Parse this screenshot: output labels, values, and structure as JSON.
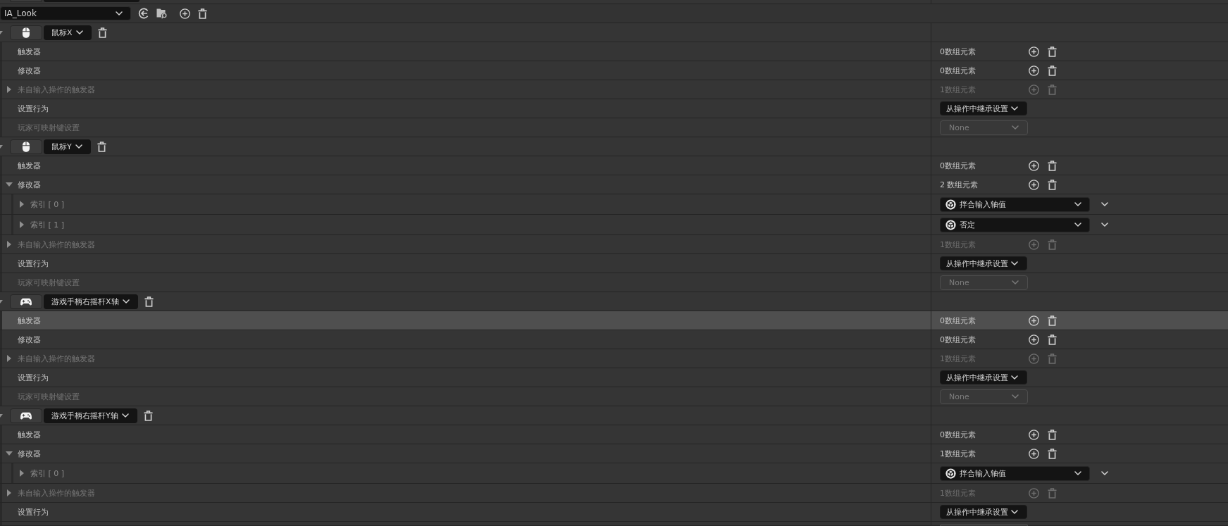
{
  "action": {
    "name": "IA_Look"
  },
  "mappings": [
    {
      "kind": "mouse",
      "key": "鼠标X",
      "expanded": true,
      "rows": [
        {
          "kind": "array",
          "label": "触发器",
          "count": "0数组元素",
          "disabled": false,
          "highlighted": false
        },
        {
          "kind": "array",
          "label": "修改器",
          "count": "0数组元素",
          "disabled": false,
          "highlighted": false
        },
        {
          "kind": "array",
          "label": "来自输入操作的触发器",
          "count": "1数组元素",
          "disabled": true,
          "highlighted": false,
          "expanded": false
        },
        {
          "kind": "dropdown",
          "label": "设置行为",
          "value": "从操作中继承设置",
          "disabled": false,
          "highlighted": false
        },
        {
          "kind": "dropdown",
          "label": "玩家可映射键设置",
          "value": "None",
          "disabled": true,
          "highlighted": false
        }
      ]
    },
    {
      "kind": "mouse",
      "key": "鼠标Y",
      "expanded": true,
      "rows": [
        {
          "kind": "array",
          "label": "触发器",
          "count": "0数组元素",
          "disabled": false,
          "highlighted": false
        },
        {
          "kind": "array",
          "label": "修改器",
          "count": "2 数组元素",
          "disabled": false,
          "highlighted": false,
          "expanded": true,
          "children": [
            {
              "kind": "modifier",
              "label": "索引 [ 0 ]",
              "value": "拌合输入轴值",
              "expanded": false
            },
            {
              "kind": "modifier",
              "label": "索引 [ 1 ]",
              "value": "否定",
              "expanded": false
            }
          ]
        },
        {
          "kind": "array",
          "label": "来自输入操作的触发器",
          "count": "1数组元素",
          "disabled": true,
          "highlighted": false,
          "expanded": false
        },
        {
          "kind": "dropdown",
          "label": "设置行为",
          "value": "从操作中继承设置",
          "disabled": false,
          "highlighted": false
        },
        {
          "kind": "dropdown",
          "label": "玩家可映射键设置",
          "value": "None",
          "disabled": true,
          "highlighted": false
        }
      ]
    },
    {
      "kind": "gamepad",
      "key": "游戏手柄右摇杆X轴",
      "expanded": true,
      "rows": [
        {
          "kind": "array",
          "label": "触发器",
          "count": "0数组元素",
          "disabled": false,
          "highlighted": true
        },
        {
          "kind": "array",
          "label": "修改器",
          "count": "0数组元素",
          "disabled": false,
          "highlighted": false
        },
        {
          "kind": "array",
          "label": "来自输入操作的触发器",
          "count": "1数组元素",
          "disabled": true,
          "highlighted": false,
          "expanded": false
        },
        {
          "kind": "dropdown",
          "label": "设置行为",
          "value": "从操作中继承设置",
          "disabled": false,
          "highlighted": false
        },
        {
          "kind": "dropdown",
          "label": "玩家可映射键设置",
          "value": "None",
          "disabled": true,
          "highlighted": false
        }
      ]
    },
    {
      "kind": "gamepad",
      "key": "游戏手柄右摇杆Y轴",
      "expanded": true,
      "rows": [
        {
          "kind": "array",
          "label": "触发器",
          "count": "0数组元素",
          "disabled": false,
          "highlighted": false
        },
        {
          "kind": "array",
          "label": "修改器",
          "count": "1数组元素",
          "disabled": false,
          "highlighted": false,
          "expanded": true,
          "children": [
            {
              "kind": "modifier",
              "label": "索引 [ 0 ]",
              "value": "拌合输入轴值",
              "expanded": false
            }
          ]
        },
        {
          "kind": "array",
          "label": "来自输入操作的触发器",
          "count": "1数组元素",
          "disabled": true,
          "highlighted": false,
          "expanded": false
        },
        {
          "kind": "dropdown",
          "label": "设置行为",
          "value": "从操作中继承设置",
          "disabled": false,
          "highlighted": false
        }
      ]
    }
  ]
}
